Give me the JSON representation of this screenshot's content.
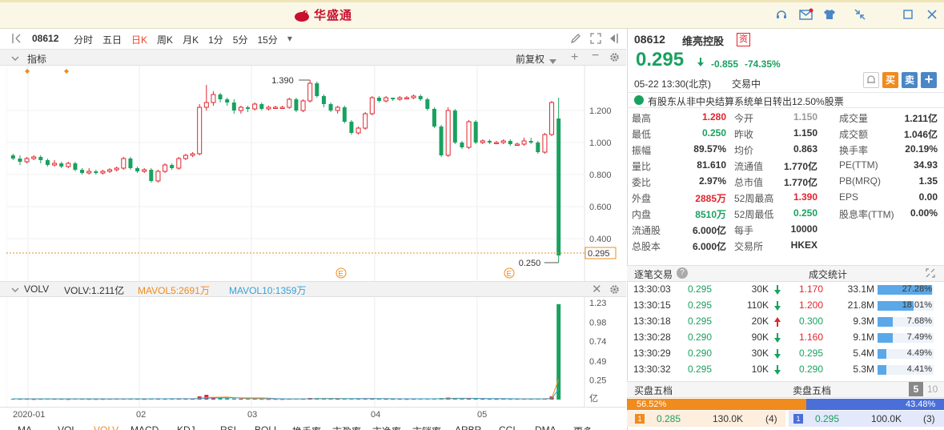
{
  "app": {
    "brand": "华盛通"
  },
  "toolbar": {
    "code": "08612",
    "periods": [
      "分时",
      "五日",
      "日K",
      "周K",
      "月K",
      "1分",
      "5分",
      "15分"
    ],
    "active_period": "日K"
  },
  "indicator_bar": {
    "label": "指标",
    "rights": "前复权"
  },
  "volume_bar": {
    "name": "VOLV",
    "volv": "VOLV:1.211亿",
    "mavol5": "MAVOL5:2691万",
    "mavol10": "MAVOL10:1359万"
  },
  "date_axis": [
    "2020-01",
    "02",
    "03",
    "04",
    "05"
  ],
  "bottom_tabs": [
    "MA",
    "VOL",
    "VOLV",
    "MACD",
    "KDJ",
    "RSI",
    "BOLL",
    "换手率",
    "市盈率",
    "市净率",
    "市销率",
    "ARBR",
    "CCI",
    "DMA",
    "更多"
  ],
  "stock": {
    "code": "08612",
    "name": "维亮控股",
    "badge": "资",
    "price": "0.295",
    "change": "-0.855",
    "change_pct": "-74.35%",
    "datetime": "05-22 13:30(北京)",
    "status": "交易中",
    "buy_label": "买",
    "sell_label": "卖",
    "plus_label": "+",
    "notice": "有股东从非中央结算系统单日转出12.50%股票"
  },
  "stats": [
    [
      [
        "最高",
        "1.280",
        "red"
      ],
      [
        "今开",
        "1.150",
        "grey"
      ],
      [
        "成交量",
        "1.211亿",
        ""
      ]
    ],
    [
      [
        "最低",
        "0.250",
        "green"
      ],
      [
        "昨收",
        "1.150",
        ""
      ],
      [
        "成交额",
        "1.046亿",
        ""
      ]
    ],
    [
      [
        "振幅",
        "89.57%",
        ""
      ],
      [
        "均价",
        "0.863",
        ""
      ],
      [
        "换手率",
        "20.19%",
        ""
      ]
    ],
    [
      [
        "量比",
        "81.610",
        ""
      ],
      [
        "流通值",
        "1.770亿",
        ""
      ],
      [
        "PE(TTM)",
        "34.93",
        ""
      ]
    ],
    [
      [
        "委比",
        "2.97%",
        ""
      ],
      [
        "总市值",
        "1.770亿",
        ""
      ],
      [
        "PB(MRQ)",
        "1.35",
        ""
      ]
    ],
    [
      [
        "外盘",
        "2885万",
        "red"
      ],
      [
        "52周最高",
        "1.390",
        "red"
      ],
      [
        "EPS",
        "0.00",
        ""
      ]
    ],
    [
      [
        "内盘",
        "8510万",
        "green"
      ],
      [
        "52周最低",
        "0.250",
        "green"
      ],
      [
        "股息率(TTM)",
        "0.00%",
        ""
      ]
    ],
    [
      [
        "流通股",
        "6.000亿",
        ""
      ],
      [
        "每手",
        "10000",
        ""
      ]
    ],
    [
      [
        "总股本",
        "6.000亿",
        ""
      ],
      [
        "交易所",
        "HKEX",
        ""
      ]
    ]
  ],
  "trades": {
    "title": "逐笔交易",
    "help_label": "?",
    "rows": [
      [
        "13:30:03",
        "0.295",
        "30K",
        "down"
      ],
      [
        "13:30:15",
        "0.295",
        "110K",
        "down"
      ],
      [
        "13:30:18",
        "0.295",
        "20K",
        "up"
      ],
      [
        "13:30:28",
        "0.290",
        "90K",
        "down"
      ],
      [
        "13:30:29",
        "0.290",
        "30K",
        "down"
      ],
      [
        "13:30:32",
        "0.295",
        "10K",
        "down"
      ]
    ]
  },
  "turnover_stats": {
    "title": "成交统计",
    "rows": [
      [
        "1.170",
        "33.1M",
        "27.28%",
        "red",
        27.28
      ],
      [
        "1.200",
        "21.8M",
        "18.01%",
        "red",
        18.01
      ],
      [
        "0.300",
        "9.3M",
        "7.68%",
        "green",
        7.68
      ],
      [
        "1.160",
        "9.1M",
        "7.49%",
        "red",
        7.49
      ],
      [
        "0.295",
        "5.4M",
        "4.49%",
        "green",
        4.49
      ],
      [
        "0.290",
        "5.3M",
        "4.41%",
        "green",
        4.41
      ]
    ]
  },
  "order_book": {
    "buy_title": "买盘五档",
    "sell_title": "卖盘五档",
    "depth_active": "5",
    "depth_other": "10",
    "buy_pct": "56.52%",
    "sell_pct": "43.48%",
    "buy_ratio": 56.52,
    "bid": [
      "1",
      "0.285",
      "130.0K",
      "(4)"
    ],
    "ask": [
      "1",
      "0.295",
      "100.0K",
      "(3)"
    ]
  },
  "colors": {
    "up": "#e0252d",
    "down": "#19a15f",
    "accent": "#f08b1d",
    "blue": "#4a87c6"
  },
  "chart_data": {
    "type": "candlestick",
    "y_ticks": [
      "1.200",
      "1.000",
      "0.800",
      "0.600",
      "0.400"
    ],
    "ylim": [
      0.25,
      1.39
    ],
    "annotations": {
      "high": "1.390",
      "low": "0.250",
      "last": "0.295"
    },
    "volume_ticks": [
      "1.23",
      "0.98",
      "0.74",
      "0.49",
      "0.25",
      "亿"
    ],
    "candles": [
      [
        0.92,
        0.9,
        0.93,
        0.89
      ],
      [
        0.9,
        0.88,
        0.92,
        0.86
      ],
      [
        0.88,
        0.9,
        0.91,
        0.87
      ],
      [
        0.9,
        0.91,
        0.92,
        0.89
      ],
      [
        0.91,
        0.89,
        0.92,
        0.87
      ],
      [
        0.89,
        0.86,
        0.9,
        0.85
      ],
      [
        0.86,
        0.87,
        0.89,
        0.85
      ],
      [
        0.87,
        0.85,
        0.88,
        0.84
      ],
      [
        0.85,
        0.87,
        0.88,
        0.84
      ],
      [
        0.87,
        0.83,
        0.88,
        0.82
      ],
      [
        0.83,
        0.81,
        0.84,
        0.8
      ],
      [
        0.81,
        0.82,
        0.84,
        0.8
      ],
      [
        0.82,
        0.81,
        0.83,
        0.8
      ],
      [
        0.81,
        0.82,
        0.83,
        0.8
      ],
      [
        0.82,
        0.83,
        0.84,
        0.81
      ],
      [
        0.83,
        0.84,
        0.85,
        0.82
      ],
      [
        0.84,
        0.9,
        0.91,
        0.83
      ],
      [
        0.9,
        0.84,
        0.91,
        0.83
      ],
      [
        0.84,
        0.82,
        0.85,
        0.81
      ],
      [
        0.82,
        0.83,
        0.84,
        0.81
      ],
      [
        0.83,
        0.76,
        0.84,
        0.75
      ],
      [
        0.76,
        0.82,
        0.83,
        0.75
      ],
      [
        0.82,
        0.86,
        0.87,
        0.81
      ],
      [
        0.86,
        0.84,
        0.87,
        0.83
      ],
      [
        0.84,
        0.9,
        0.91,
        0.83
      ],
      [
        0.9,
        0.92,
        0.93,
        0.89
      ],
      [
        0.92,
        0.93,
        0.94,
        0.91
      ],
      [
        0.93,
        1.22,
        1.24,
        0.92
      ],
      [
        1.22,
        1.25,
        1.36,
        1.2
      ],
      [
        1.25,
        1.3,
        1.32,
        1.23
      ],
      [
        1.3,
        1.27,
        1.31,
        1.25
      ],
      [
        1.27,
        1.25,
        1.28,
        1.23
      ],
      [
        1.25,
        1.2,
        1.27,
        1.18
      ],
      [
        1.2,
        1.22,
        1.23,
        1.18
      ],
      [
        1.22,
        1.21,
        1.23,
        1.19
      ],
      [
        1.21,
        1.24,
        1.25,
        1.2
      ],
      [
        1.24,
        1.21,
        1.25,
        1.2
      ],
      [
        1.21,
        1.22,
        1.23,
        1.2
      ],
      [
        1.22,
        1.22,
        1.23,
        1.21
      ],
      [
        1.22,
        1.22,
        1.23,
        1.21
      ],
      [
        1.22,
        1.27,
        1.28,
        1.21
      ],
      [
        1.27,
        1.2,
        1.28,
        1.19
      ],
      [
        1.2,
        1.26,
        1.27,
        1.19
      ],
      [
        1.26,
        1.37,
        1.39,
        1.25
      ],
      [
        1.37,
        1.29,
        1.38,
        1.28
      ],
      [
        1.29,
        1.24,
        1.3,
        1.22
      ],
      [
        1.24,
        1.2,
        1.25,
        1.19
      ],
      [
        1.2,
        1.22,
        1.23,
        1.18
      ],
      [
        1.22,
        1.13,
        1.23,
        1.12
      ],
      [
        1.13,
        1.06,
        1.14,
        1.05
      ],
      [
        1.06,
        1.09,
        1.1,
        1.05
      ],
      [
        1.09,
        1.18,
        1.19,
        1.08
      ],
      [
        1.18,
        1.28,
        1.29,
        1.17
      ],
      [
        1.28,
        1.26,
        1.29,
        1.25
      ],
      [
        1.26,
        1.28,
        1.29,
        1.25
      ],
      [
        1.28,
        1.27,
        1.28,
        1.26
      ],
      [
        1.27,
        1.28,
        1.29,
        1.26
      ],
      [
        1.28,
        1.28,
        1.29,
        1.27
      ],
      [
        1.28,
        1.29,
        1.3,
        1.27
      ],
      [
        1.29,
        1.27,
        1.3,
        1.26
      ],
      [
        1.27,
        1.21,
        1.28,
        1.2
      ],
      [
        1.21,
        1.1,
        1.22,
        1.09
      ],
      [
        1.1,
        0.92,
        1.11,
        0.91
      ],
      [
        0.92,
        1.2,
        1.22,
        0.91
      ],
      [
        1.2,
        1.0,
        1.21,
        0.99
      ],
      [
        1.0,
        0.97,
        1.01,
        0.96
      ],
      [
        0.97,
        1.13,
        1.14,
        0.96
      ],
      [
        1.13,
        1.0,
        1.14,
        0.99
      ],
      [
        1.0,
        1.01,
        1.02,
        0.99
      ],
      [
        1.01,
        1.0,
        1.02,
        0.99
      ],
      [
        1.0,
        1.0,
        1.01,
        0.99
      ],
      [
        1.0,
        1.01,
        1.02,
        0.99
      ],
      [
        1.01,
        0.99,
        1.02,
        0.98
      ],
      [
        0.99,
        0.99,
        1.0,
        0.98
      ],
      [
        0.99,
        1.01,
        1.03,
        0.98
      ],
      [
        1.01,
        1.0,
        1.03,
        0.99
      ],
      [
        1.0,
        0.94,
        1.01,
        0.93
      ],
      [
        0.94,
        1.05,
        1.06,
        0.93
      ],
      [
        1.05,
        1.25,
        1.26,
        1.04
      ],
      [
        1.15,
        0.295,
        1.28,
        0.25
      ]
    ],
    "volumes": [
      0.01,
      0.008,
      0.009,
      0.007,
      0.008,
      0.01,
      0.009,
      0.008,
      0.007,
      0.011,
      0.009,
      0.008,
      0.007,
      0.008,
      0.009,
      0.01,
      0.012,
      0.01,
      0.009,
      0.008,
      0.011,
      0.013,
      0.012,
      0.01,
      0.011,
      0.01,
      0.009,
      0.04,
      0.06,
      0.025,
      0.018,
      0.015,
      0.012,
      0.01,
      0.009,
      0.01,
      0.008,
      0.007,
      0.008,
      0.007,
      0.009,
      0.01,
      0.009,
      0.02,
      0.018,
      0.012,
      0.01,
      0.009,
      0.011,
      0.012,
      0.01,
      0.013,
      0.015,
      0.01,
      0.009,
      0.008,
      0.009,
      0.008,
      0.009,
      0.01,
      0.011,
      0.012,
      0.018,
      0.025,
      0.015,
      0.01,
      0.013,
      0.011,
      0.009,
      0.008,
      0.008,
      0.009,
      0.008,
      0.009,
      0.01,
      0.009,
      0.011,
      0.013,
      0.04,
      1.211
    ]
  }
}
